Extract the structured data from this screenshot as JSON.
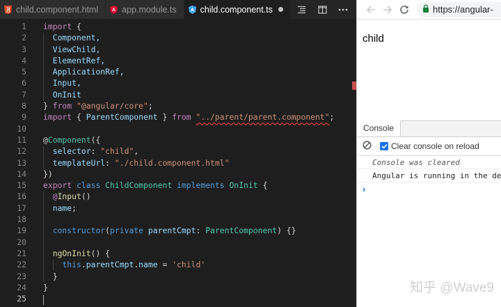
{
  "editor": {
    "tabs": [
      {
        "label": "child.component.html",
        "icon": "html5-icon",
        "active": false
      },
      {
        "label": "app.module.ts",
        "icon": "angular-icon",
        "active": false
      },
      {
        "label": "child.component.ts",
        "icon": "angular-icon",
        "active": true,
        "unsaved": true
      }
    ],
    "actions": [
      "outline-icon",
      "split-editor-icon",
      "more-icon"
    ],
    "line_numbers": [
      "1",
      "2",
      "3",
      "4",
      "5",
      "6",
      "7",
      "8",
      "9",
      "10",
      "11",
      "12",
      "13",
      "14",
      "15",
      "16",
      "17",
      "18",
      "19",
      "20",
      "21",
      "22",
      "23",
      "24",
      "25"
    ],
    "current_line": "25",
    "code": {
      "l1_kw": "import",
      "l1_p": " {",
      "l2": "Component,",
      "l3": "ViewChild,",
      "l4": "ElementRef,",
      "l5": "ApplicationRef,",
      "l6": "Input,",
      "l7": "OnInit",
      "l8_p": "} ",
      "l8_kw": "from",
      "l8_s": "\"@angular/core\"",
      "l8_e": ";",
      "l9_kw": "import",
      "l9_p1": " { ",
      "l9_v": "ParentComponent",
      "l9_p2": " } ",
      "l9_kw2": "from",
      "l9_sp": " ",
      "l9_s": "\"../parent/parent.component\"",
      "l9_e": ";",
      "l11_at": "@",
      "l11_fn": "Component",
      "l11_p": "({",
      "l12_k": "selector",
      "l12_p": ": ",
      "l12_s": "\"child\"",
      "l12_e": ",",
      "l13_k": "templateUrl",
      "l13_p": ": ",
      "l13_s": "\"./child.component.html\"",
      "l14": "})",
      "l15_kw1": "export",
      "l15_kw2": " class ",
      "l15_ty": "ChildComponent",
      "l15_kw3": " implements ",
      "l15_ty2": "OnInit",
      "l15_p": " {",
      "l16_at": "@",
      "l16_fn": "Input",
      "l16_p": "()",
      "l17_v": "name",
      "l17_p": ";",
      "l19_kw": "constructor",
      "l19_p1": "(",
      "l19_kw2": "private",
      "l19_sp": " ",
      "l19_v": "parentCmpt",
      "l19_p2": ": ",
      "l19_ty": "ParentComponent",
      "l19_p3": ") {}",
      "l21_fn": "ngOnInit",
      "l21_p": "() {",
      "l22_kw": "this",
      "l22_p1": ".",
      "l22_v1": "parentCmpt",
      "l22_p2": ".",
      "l22_v2": "name",
      "l22_p3": " = ",
      "l22_s": "'child'",
      "l23": "}",
      "l24": "}"
    }
  },
  "browser": {
    "back_icon": "back-arrow-icon",
    "forward_icon": "forward-arrow-icon",
    "reload_icon": "reload-icon",
    "url": "https://angular-",
    "page_text": "child",
    "devtools": {
      "tab": "Console",
      "clear_checkbox_label": "Clear console on reload",
      "messages": [
        "Console was cleared",
        "Angular is running in the dev"
      ],
      "prompt": "›"
    }
  },
  "watermark": "知乎 @Wave9",
  "colors": {
    "accent": "#1a73e8",
    "keyword": "#569cd6",
    "type": "#4ec9b0",
    "string": "#ce9178",
    "editor_bg": "#1e1e1e"
  }
}
